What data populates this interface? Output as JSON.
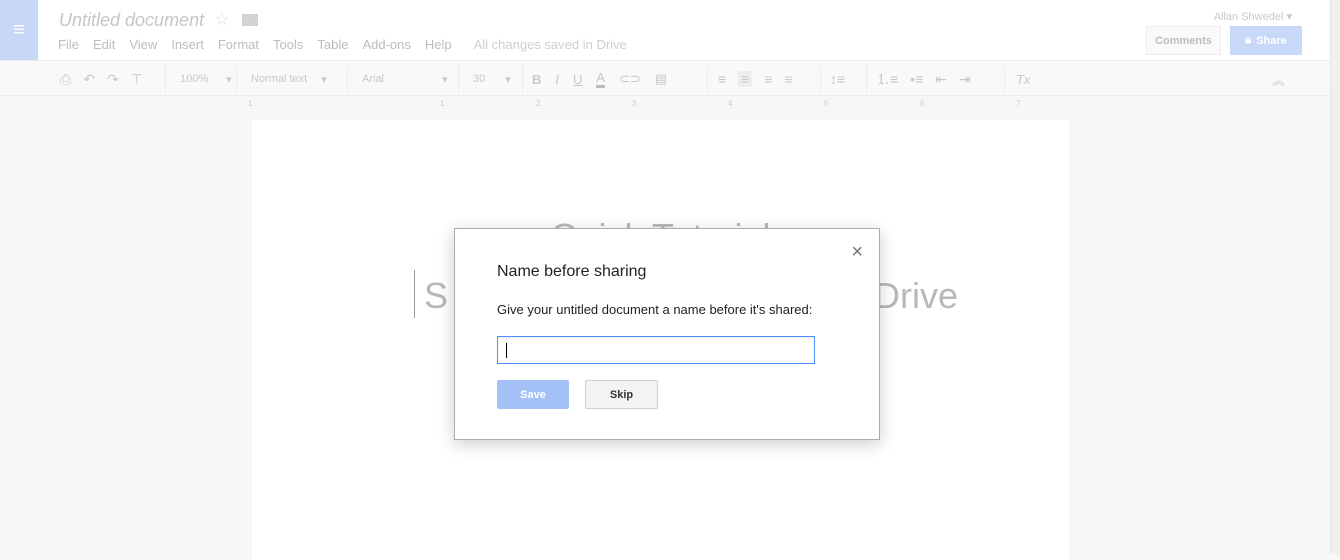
{
  "header": {
    "title": "Untitled document",
    "menu": [
      "File",
      "Edit",
      "View",
      "Insert",
      "Format",
      "Tools",
      "Table",
      "Add-ons",
      "Help"
    ],
    "save_status": "All changes saved in Drive",
    "user": "Allan Shwedel ▾",
    "comments": "Comments",
    "share": "Share"
  },
  "toolbar": {
    "zoom": "100%",
    "style": "Normal text",
    "font": "Arial",
    "size": "30",
    "bold": "B",
    "italic": "I",
    "underline": "U",
    "text_color": "A",
    "clear": "Tx",
    "caret": "▾"
  },
  "ruler": [
    "1",
    "1",
    "2",
    "3",
    "4",
    "5",
    "6",
    "7"
  ],
  "document": {
    "heading": "Quick Tutorial",
    "subheading_visible_left": "S",
    "subheading_visible_right": "Drive"
  },
  "dialog": {
    "title": "Name before sharing",
    "message": "Give your untitled document a name before it's shared:",
    "input_value": "",
    "save": "Save",
    "skip": "Skip",
    "close": "×"
  },
  "colors": {
    "accent": "#4d90fe",
    "share_disabled": "#c7d8f9",
    "save_disabled": "#a3c0f7"
  }
}
